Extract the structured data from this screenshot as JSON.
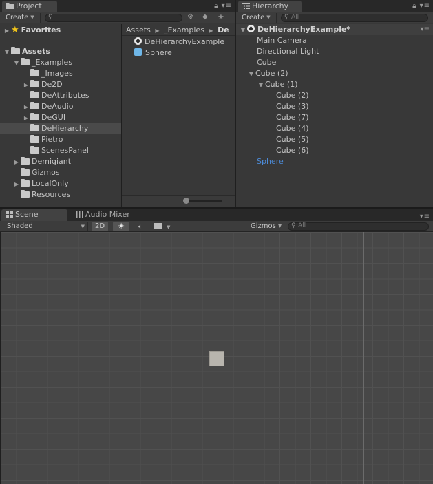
{
  "project": {
    "tab_label": "Project",
    "create_label": "Create",
    "favorites_label": "Favorites",
    "assets_label": "Assets",
    "tree": [
      {
        "label": "_Examples",
        "expanded": true
      },
      {
        "label": "_Images"
      },
      {
        "label": "De2D"
      },
      {
        "label": "DeAttributes"
      },
      {
        "label": "DeAudio"
      },
      {
        "label": "DeGUI"
      },
      {
        "label": "DeHierarchy",
        "selected": true
      },
      {
        "label": "Pietro"
      },
      {
        "label": "ScenesPanel"
      },
      {
        "label": "Demigiant"
      },
      {
        "label": "Gizmos"
      },
      {
        "label": "LocalOnly"
      },
      {
        "label": "Resources"
      }
    ],
    "breadcrumb": [
      "Assets",
      "_Examples",
      "De"
    ],
    "files": [
      {
        "label": "DeHierarchyExample",
        "icon": "unity-scene-icon"
      },
      {
        "label": "Sphere",
        "icon": "prefab-cube-icon"
      }
    ]
  },
  "hierarchy": {
    "tab_label": "Hierarchy",
    "create_label": "Create",
    "search_placeholder": "All",
    "scene_name": "DeHierarchyExample*",
    "items": [
      {
        "label": "Main Camera"
      },
      {
        "label": "Directional Light"
      },
      {
        "label": "Cube"
      },
      {
        "label": "Cube (2)",
        "expanded": true
      },
      {
        "label": "Cube (1)",
        "expanded": true
      },
      {
        "label": "Cube (2)"
      },
      {
        "label": "Cube (3)"
      },
      {
        "label": "Cube (7)"
      },
      {
        "label": "Cube (4)"
      },
      {
        "label": "Cube (5)"
      },
      {
        "label": "Cube (6)"
      },
      {
        "label": "Sphere",
        "color": "#4c8ad6"
      }
    ]
  },
  "scene": {
    "tab_label": "Scene",
    "audio_tab_label": "Audio Mixer",
    "shading_label": "Shaded",
    "mode_2d_label": "2D",
    "gizmos_label": "Gizmos",
    "search_placeholder": "All"
  },
  "colors": {
    "accent_blue": "#4c8ad6",
    "favorites_star": "#f0c41b"
  }
}
